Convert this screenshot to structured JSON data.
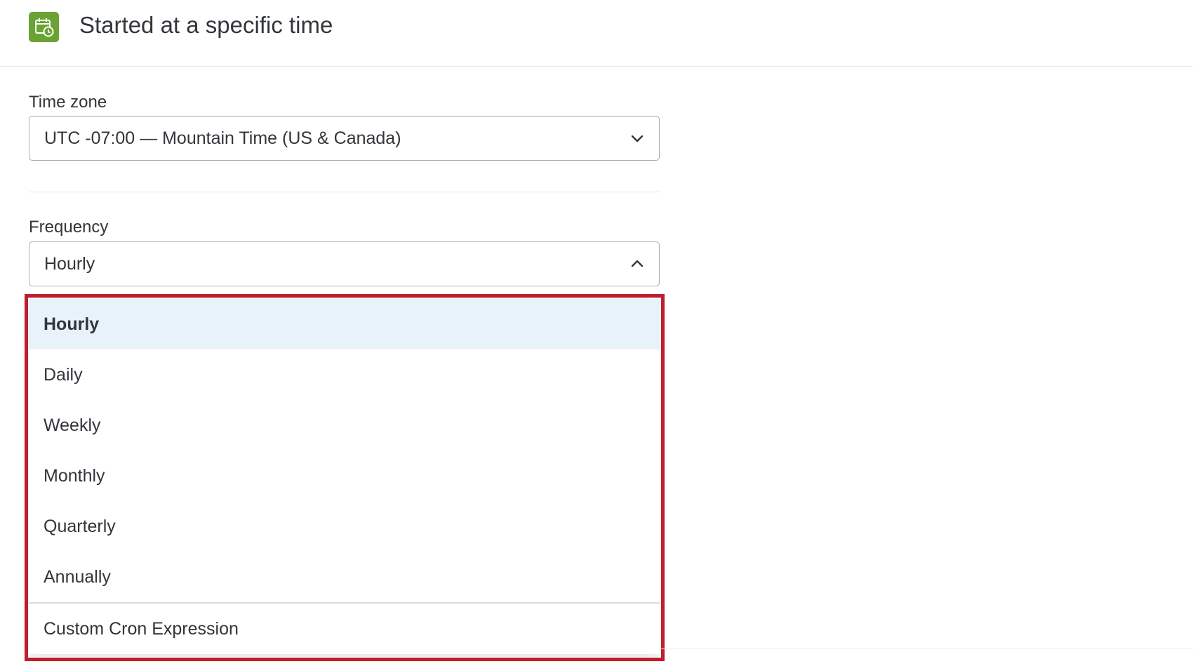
{
  "header": {
    "title": "Started at a specific time",
    "icon": "calendar-clock-icon",
    "icon_color": "#6aa333"
  },
  "timezone": {
    "label": "Time zone",
    "value": "UTC -07:00 — Mountain Time (US & Canada)"
  },
  "frequency": {
    "label": "Frequency",
    "value": "Hourly",
    "expanded": true,
    "options": [
      {
        "label": "Hourly",
        "selected": true
      },
      {
        "label": "Daily"
      },
      {
        "label": "Weekly"
      },
      {
        "label": "Monthly"
      },
      {
        "label": "Quarterly"
      },
      {
        "label": "Annually"
      },
      {
        "label": "Custom Cron Expression"
      }
    ]
  },
  "colors": {
    "highlight_frame": "#bf1e2e",
    "selected_option_bg": "#e8f2fb"
  }
}
